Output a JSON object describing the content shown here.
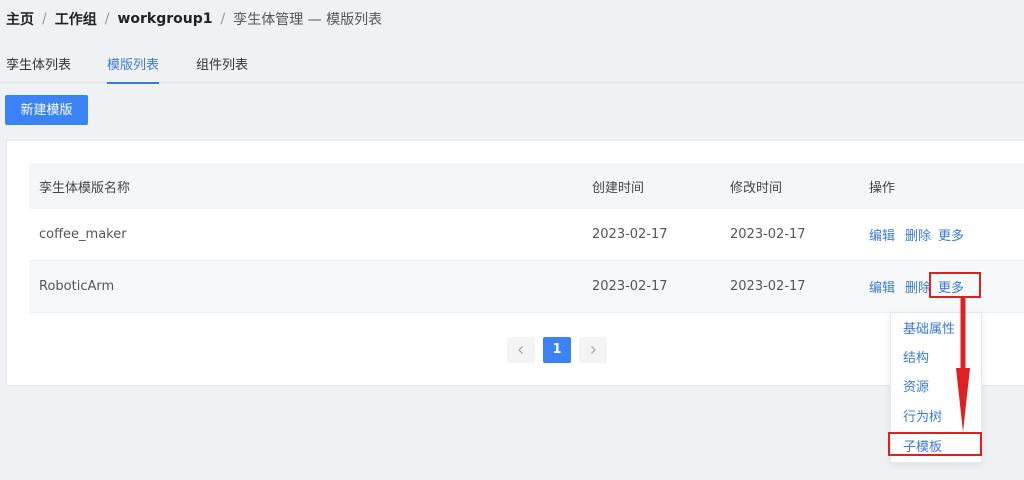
{
  "breadcrumb": {
    "home": "主页",
    "workgroup": "工作组",
    "workgroup_name": "workgroup1",
    "current": "孪生体管理 — 模版列表",
    "separator": "/"
  },
  "tabs": [
    {
      "label": "孪生体列表",
      "active": false
    },
    {
      "label": "模版列表",
      "active": true
    },
    {
      "label": "组件列表",
      "active": false
    }
  ],
  "toolbar": {
    "new_label": "新建模版"
  },
  "table": {
    "columns": [
      "孪生体模版名称",
      "创建时间",
      "修改时间",
      "操作"
    ],
    "rows": [
      {
        "name": "coffee_maker",
        "created": "2023-02-17",
        "modified": "2023-02-17"
      },
      {
        "name": "RoboticArm",
        "created": "2023-02-17",
        "modified": "2023-02-17"
      }
    ],
    "actions": {
      "edit": "编辑",
      "delete": "删除",
      "more": "更多"
    }
  },
  "pagination": {
    "prev_icon": "chevron-left-icon",
    "current_page": "1",
    "next_icon": "chevron-right-icon"
  },
  "dropdown": {
    "items": [
      "基础属性",
      "结构",
      "资源",
      "行为树",
      "子模板"
    ]
  },
  "colors": {
    "accent": "#3b82f6",
    "link": "#3a7bd5",
    "highlight": "#e02020"
  }
}
